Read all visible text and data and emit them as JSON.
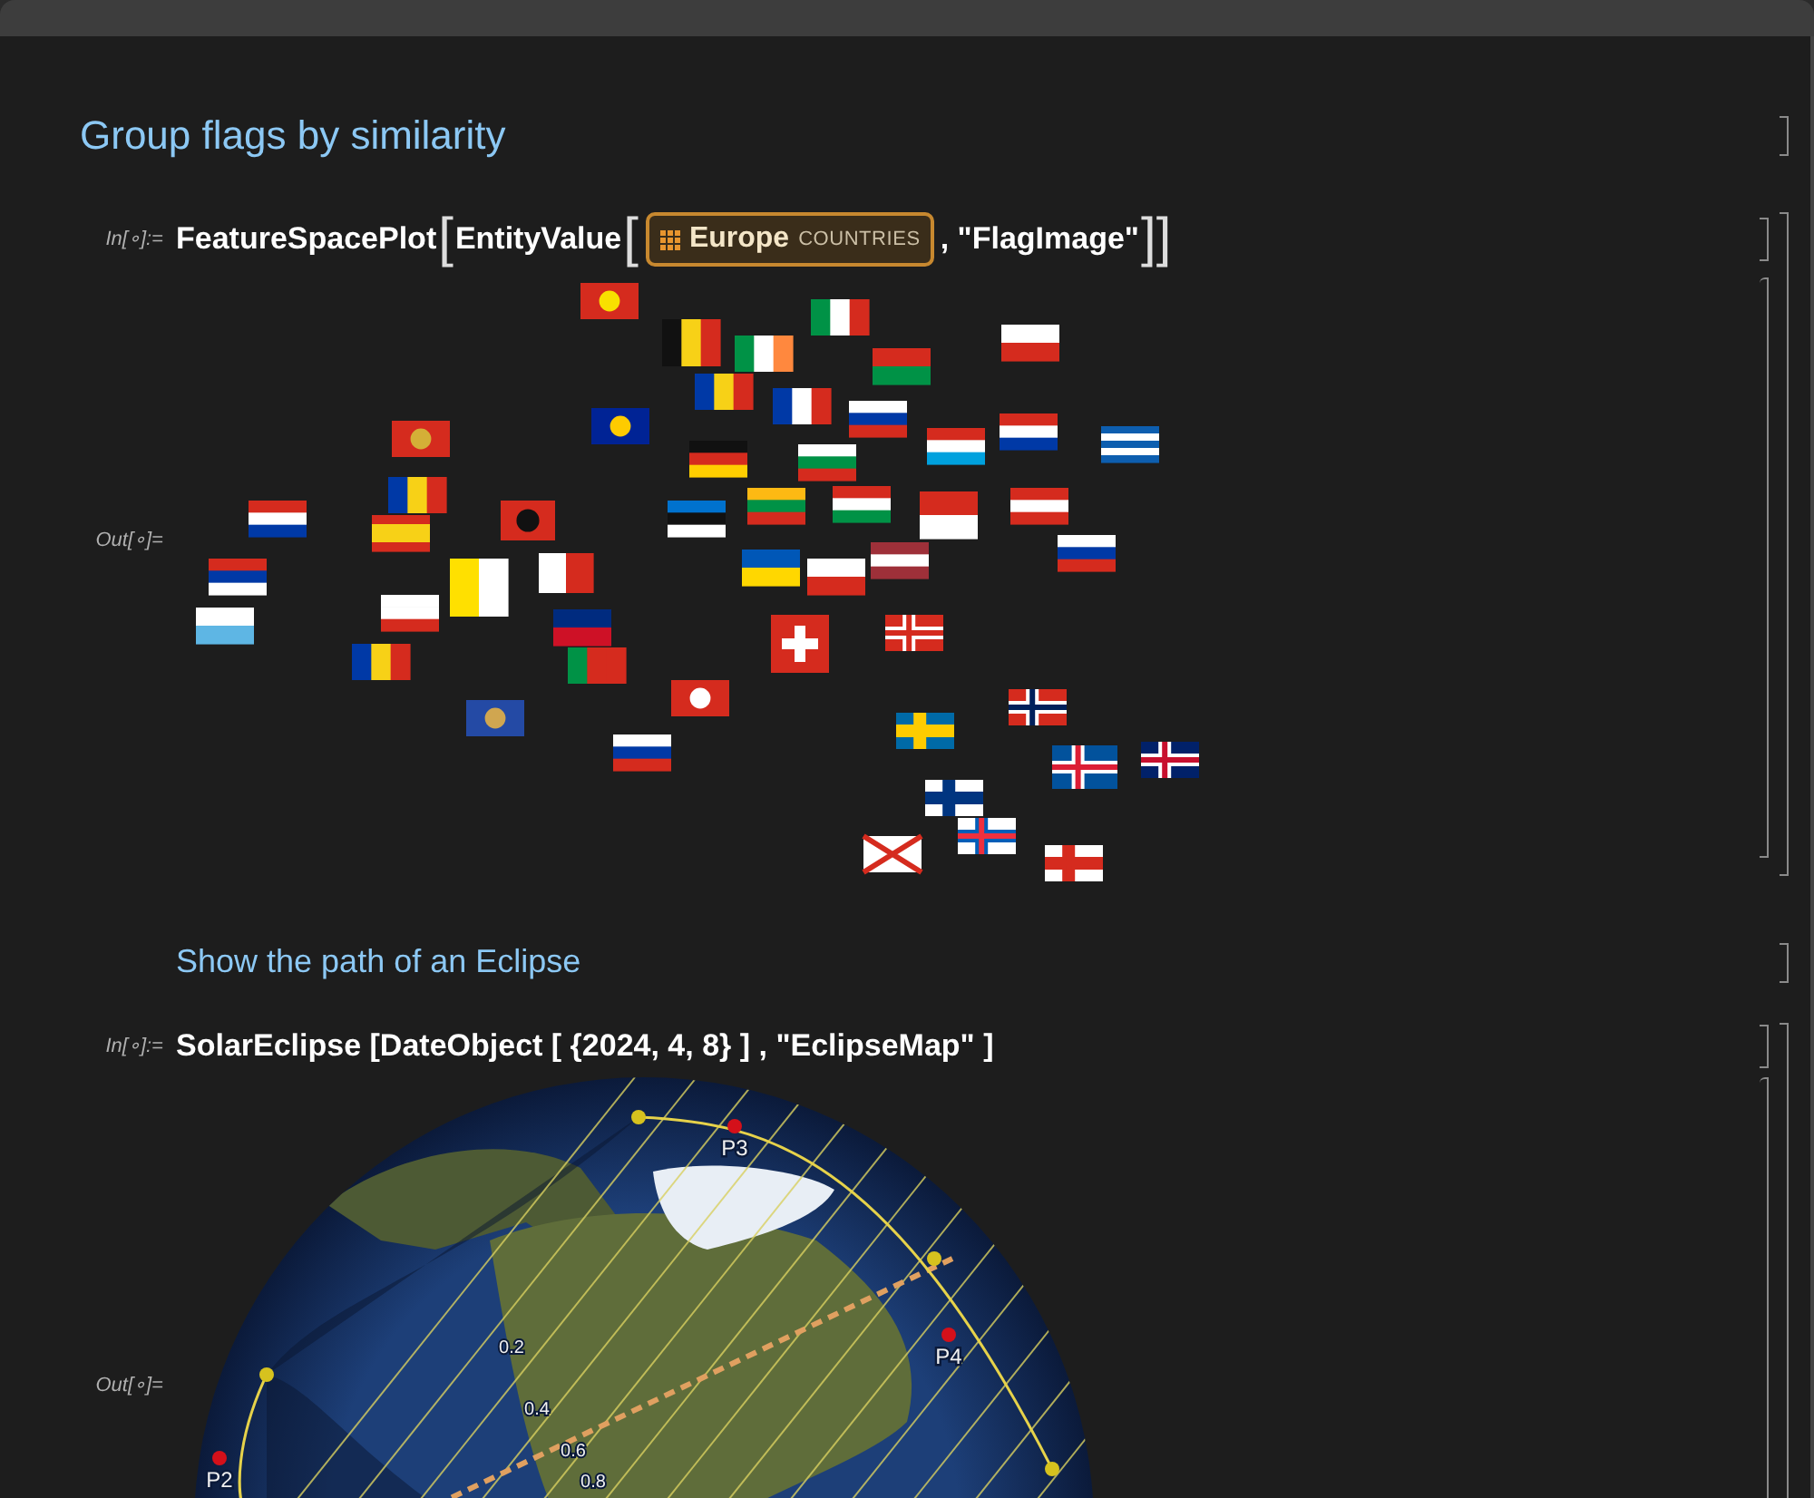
{
  "cells": [
    {
      "kind": "title",
      "text": "Group flags by similarity"
    },
    {
      "kind": "group",
      "input": {
        "label": "In[∘]:=",
        "tokens": [
          {
            "kind": "text",
            "text": "FeatureSpacePlot"
          },
          {
            "kind": "bracket",
            "text": "["
          },
          {
            "kind": "text",
            "text": "EntityValue"
          },
          {
            "kind": "bracket",
            "text": "["
          },
          {
            "kind": "entity",
            "text": "Europe",
            "sublabel": "COUNTRIES"
          },
          {
            "kind": "text",
            "text": ", \"FlagImage\""
          },
          {
            "kind": "bracket",
            "text": "]]"
          }
        ]
      },
      "output": {
        "label": "Out[∘]=",
        "kind": "flag_plot"
      }
    },
    {
      "kind": "subsection",
      "text": "Show the path of an Eclipse"
    },
    {
      "kind": "group",
      "input": {
        "label": "In[∘]:=",
        "tokens": [
          {
            "kind": "text",
            "text": "SolarEclipse [DateObject [ {2024, 4, 8} ] , \"EclipseMap\" ]"
          }
        ]
      },
      "output": {
        "label": "Out[∘]=",
        "kind": "eclipse_map",
        "point_labels": [
          "P3",
          "P4",
          "P2"
        ],
        "contour_labels": [
          "0.2",
          "0.4",
          "0.6",
          "0.8"
        ]
      }
    }
  ]
}
